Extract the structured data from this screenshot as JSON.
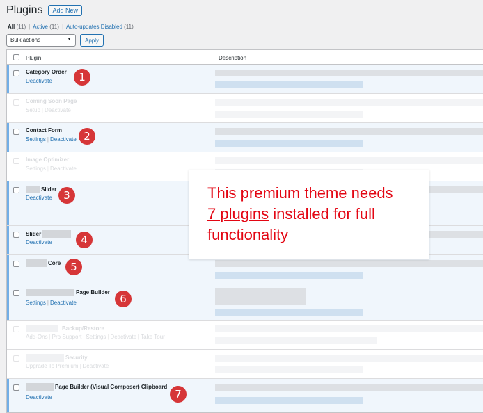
{
  "header": {
    "title": "Plugins",
    "add_new": "Add New"
  },
  "filters": {
    "all": "All",
    "all_count": "(11)",
    "active": "Active",
    "active_count": "(11)",
    "auto": "Auto-updates Disabled",
    "auto_count": "(11)"
  },
  "bulk": {
    "selected": "Bulk actions",
    "apply": "Apply"
  },
  "table": {
    "col_plugin": "Plugin",
    "col_desc": "Description"
  },
  "plugins": [
    {
      "name": "Category Order",
      "actions": [
        "Deactivate"
      ],
      "active": true,
      "badge": "1"
    },
    {
      "name": "Coming Soon Page",
      "actions": [
        "Setup",
        "Deactivate"
      ],
      "active": false
    },
    {
      "name": "Contact Form",
      "actions": [
        "Settings",
        "Deactivate"
      ],
      "active": true,
      "badge": "2"
    },
    {
      "name": "Image Optimizer",
      "actions": [
        "Settings",
        "Deactivate"
      ],
      "active": false
    },
    {
      "name": "Slider",
      "actions": [
        "Deactivate"
      ],
      "active": true,
      "badge": "3"
    },
    {
      "name": "Slider",
      "actions": [
        "Deactivate"
      ],
      "active": true,
      "badge": "4"
    },
    {
      "name": "Core",
      "actions": [],
      "active": true,
      "badge": "5"
    },
    {
      "name": "Page Builder",
      "actions": [
        "Settings",
        "Deactivate"
      ],
      "active": true,
      "badge": "6"
    },
    {
      "name": "Backup/Restore",
      "actions": [
        "Add-Ons",
        "Pro Support",
        "Settings",
        "Deactivate",
        "Take Tour"
      ],
      "active": false
    },
    {
      "name": "Security",
      "actions": [
        "Upgrade To Premium",
        "Deactivate"
      ],
      "active": false
    },
    {
      "name": "Page Builder (Visual Composer) Clipboard",
      "actions": [
        "Deactivate"
      ],
      "active": true,
      "badge": "7"
    }
  ],
  "callout": {
    "line1": "This premium theme needs",
    "underlined": "7 plugins",
    "line2_rest": " installed for full",
    "line3": "functionality"
  },
  "colors": {
    "accent": "#2271b1",
    "badge": "#d63638",
    "callout_text": "#e30613",
    "active_row": "#f0f6fc"
  }
}
